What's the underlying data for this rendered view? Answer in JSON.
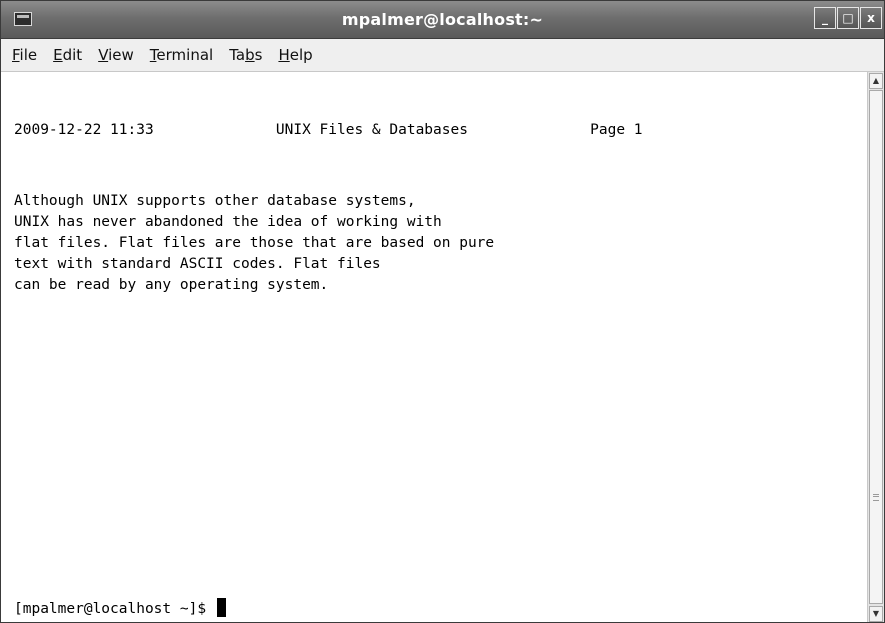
{
  "window": {
    "title": "mpalmer@localhost:~",
    "minimize_glyph": "_",
    "maximize_glyph": "□",
    "close_glyph": "x"
  },
  "menu": [
    {
      "label": "File",
      "mnemonic": "F",
      "rest": "ile",
      "prefix": ""
    },
    {
      "label": "Edit",
      "mnemonic": "E",
      "rest": "dit",
      "prefix": ""
    },
    {
      "label": "View",
      "mnemonic": "V",
      "rest": "iew",
      "prefix": ""
    },
    {
      "label": "Terminal",
      "mnemonic": "T",
      "rest": "erminal",
      "prefix": ""
    },
    {
      "label": "Tabs",
      "mnemonic": "b",
      "rest": "s",
      "prefix": "Ta"
    },
    {
      "label": "Help",
      "mnemonic": "H",
      "rest": "elp",
      "prefix": ""
    }
  ],
  "terminal": {
    "header_line": "2009-12-22 11:33              UNIX Files & Databases              Page 1",
    "body_lines": [
      "Although UNIX supports other database systems,",
      "UNIX has never abandoned the idea of working with",
      "flat files. Flat files are those that are based on pure",
      "text with standard ASCII codes. Flat files",
      "can be read by any operating system."
    ],
    "prompt": "[mpalmer@localhost ~]$ "
  },
  "scrollbar": {
    "up_arrow": "▲",
    "down_arrow": "▼"
  }
}
